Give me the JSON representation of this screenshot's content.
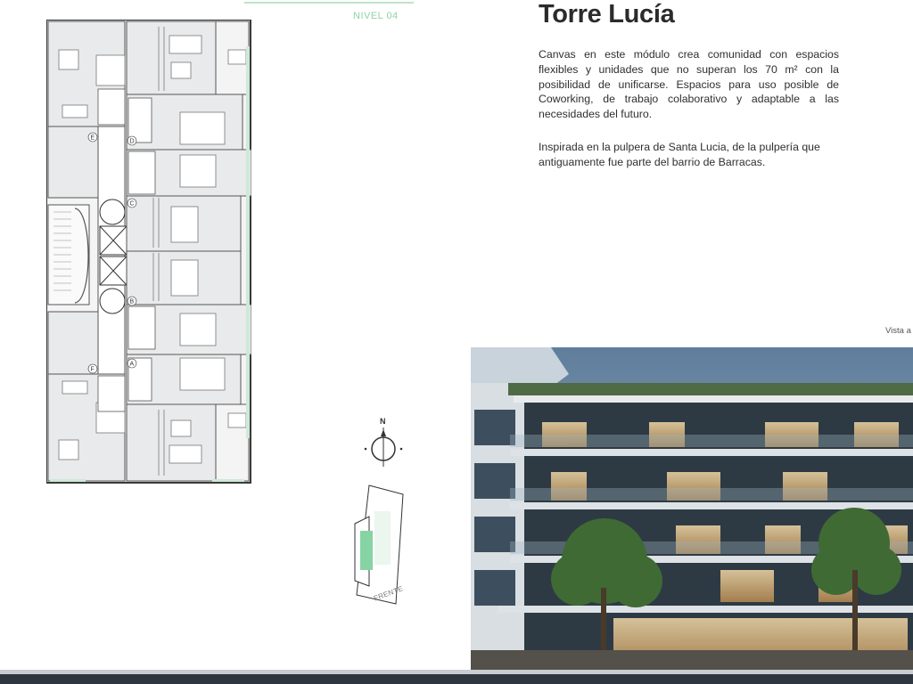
{
  "level": {
    "label": "NIVEL 04"
  },
  "header": {
    "title": "Torre Lucía"
  },
  "description": {
    "paragraph1": "Canvas en este módulo crea comunidad con espacios flexibles y unidades que no superan los 70 m² con la posibilidad de unificarse. Espacios para uso posible de Coworking, de trabajo colaborativo y adaptable a las necesidades del futuro.",
    "paragraph2": "Inspirada en la pulpera de Santa Lucia, de la pulpería que antiguamente fue parte del barrio de Barracas."
  },
  "render": {
    "caption": "Vista a"
  },
  "floorplan": {
    "unit_letters": [
      "E",
      "D",
      "C",
      "B",
      "A",
      "F"
    ]
  },
  "compass": {
    "north_label": "N"
  },
  "siteplan": {
    "front_label": "FRENTE"
  },
  "colors": {
    "accent_green": "#8fd3a6",
    "plan_fill": "#e9eaeb",
    "bottom_bar": "#2e3640"
  }
}
